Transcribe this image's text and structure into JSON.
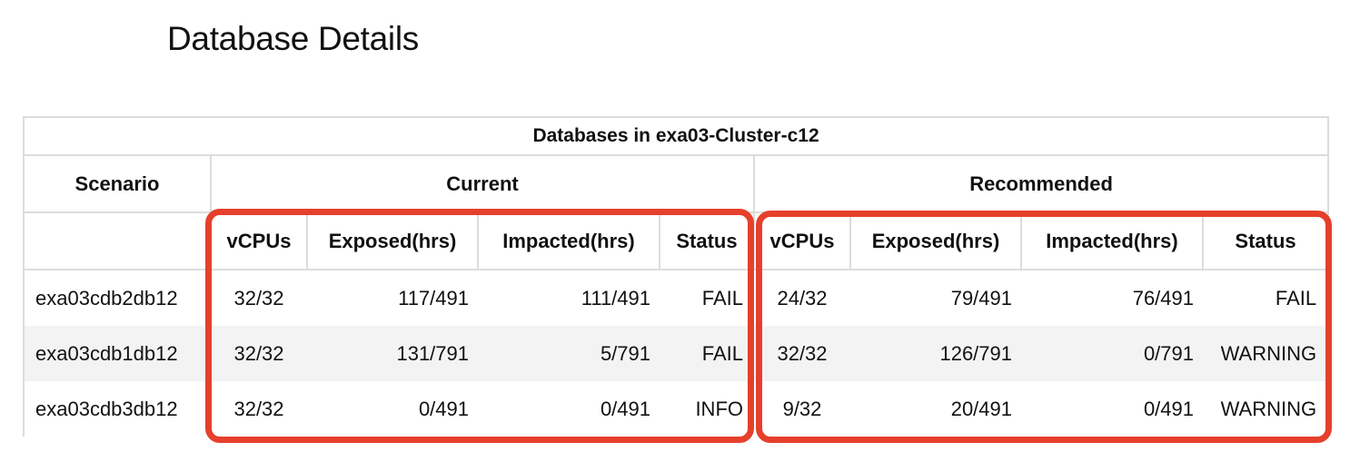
{
  "page": {
    "title": "Database Details"
  },
  "table": {
    "caption": "Databases in exa03-Cluster-c12",
    "scenario_header": "Scenario",
    "group_current": "Current",
    "group_recommended": "Recommended",
    "columns": [
      "vCPUs",
      "Exposed(hrs)",
      "Impacted(hrs)",
      "Status"
    ],
    "rows": [
      {
        "scenario": "exa03cdb2db12",
        "current": {
          "vcpus": "32/32",
          "exposed": "117/491",
          "impacted": "111/491",
          "status": "FAIL"
        },
        "recommended": {
          "vcpus": "24/32",
          "exposed": "79/491",
          "impacted": "76/491",
          "status": "FAIL"
        }
      },
      {
        "scenario": "exa03cdb1db12",
        "current": {
          "vcpus": "32/32",
          "exposed": "131/791",
          "impacted": "5/791",
          "status": "FAIL"
        },
        "recommended": {
          "vcpus": "32/32",
          "exposed": "126/791",
          "impacted": "0/791",
          "status": "WARNING"
        }
      },
      {
        "scenario": "exa03cdb3db12",
        "current": {
          "vcpus": "32/32",
          "exposed": "0/491",
          "impacted": "0/491",
          "status": "INFO"
        },
        "recommended": {
          "vcpus": "9/32",
          "exposed": "20/491",
          "impacted": "0/491",
          "status": "WARNING"
        }
      }
    ]
  },
  "highlight_color": "#e5402b"
}
